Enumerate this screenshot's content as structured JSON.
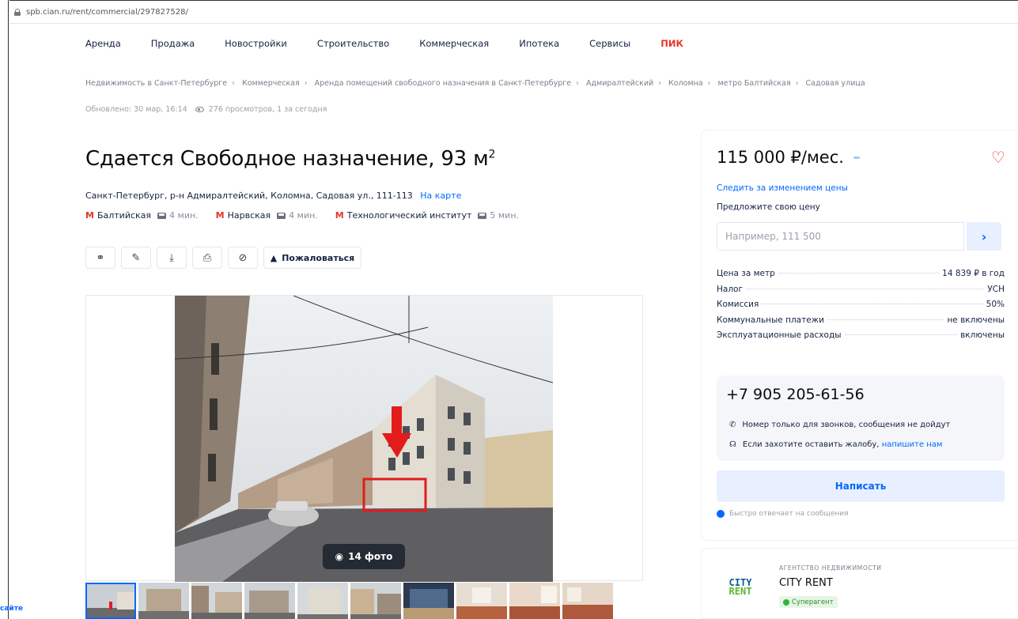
{
  "browser": {
    "url": "spb.cian.ru/rent/commercial/297827528/"
  },
  "nav": {
    "items": [
      "Аренда",
      "Продажа",
      "Новостройки",
      "Строительство",
      "Коммерческая",
      "Ипотека",
      "Сервисы"
    ],
    "brand": "ПИК"
  },
  "breadcrumbs": [
    "Недвижимость в Санкт-Петербурге",
    "Коммерческая",
    "Аренда помещений свободного назначения в Санкт-Петербурге",
    "Адмиралтейский",
    "Коломна",
    "метро Балтийская",
    "Садовая улица"
  ],
  "meta": {
    "updated": "Обновлено: 30 мар, 16:14",
    "views": "276 просмотров, 1 за сегодня"
  },
  "listing": {
    "title": "Сдается Свободное назначение, 93 м",
    "title_sup": "2",
    "address": "Санкт-Петербург, р-н Адмиралтейский, Коломна, Садовая ул., 111-113",
    "map_link": "На карте",
    "metro": [
      {
        "name": "Балтийская",
        "time": "4 мин."
      },
      {
        "name": "Нарвская",
        "time": "4 мин."
      },
      {
        "name": "Технологический институт",
        "time": "5 мин."
      }
    ],
    "metro_logo": "M"
  },
  "toolbar": {
    "complain_label": "Пожаловаться",
    "icons": [
      "share-icon",
      "edit-icon",
      "download-icon",
      "print-icon",
      "hide-icon"
    ]
  },
  "gallery": {
    "photo_count": "14 фото",
    "thumb_count": 10
  },
  "price": {
    "amount": "115 000 ₽/мес.",
    "follow": "Следить за изменением цены",
    "offer_label": "Предложите свою цену",
    "offer_placeholder": "Например, 111 500"
  },
  "facts": [
    {
      "k": "Цена за метр",
      "v": "14 839 ₽ в год"
    },
    {
      "k": "Налог",
      "v": "УСН"
    },
    {
      "k": "Комиссия",
      "v": "50%"
    },
    {
      "k": "Коммунальные платежи",
      "v": "не включены"
    },
    {
      "k": "Эксплуатационные расходы",
      "v": "включены"
    }
  ],
  "contact": {
    "phone": "+7 905 205-61-56",
    "note_calls": "Номер только для звонков, сообщения не дойдут",
    "note_complaint": "Если захотите оставить жалобу,",
    "note_complaint_link": "напишите нам",
    "write_button": "Написать",
    "fast_reply": "Быстро отвечает на сообщения"
  },
  "agency": {
    "kind": "АГЕНТСТВО НЕДВИЖИМОСТИ",
    "name": "CITY RENT",
    "badge": "Суперагент",
    "logo_top": "CITY",
    "logo_bottom": "RENT"
  },
  "side_note": "сайте",
  "colors": {
    "accent": "#0468ff",
    "brand_red": "#e8352a",
    "agency_blue": "#0a5b97",
    "agency_green": "#5cb531"
  }
}
